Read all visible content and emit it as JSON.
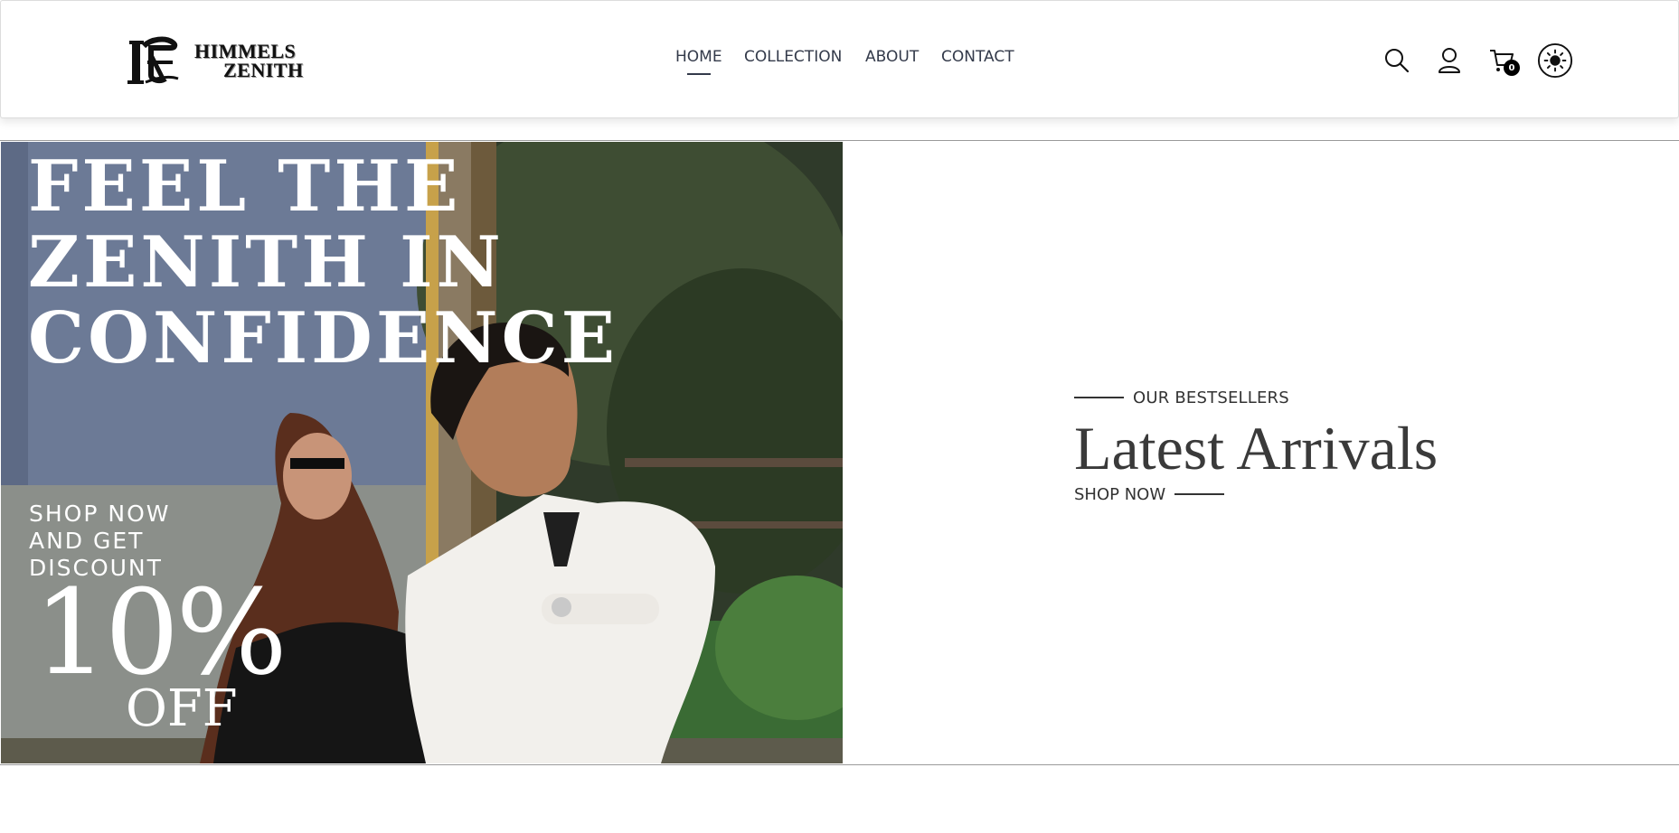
{
  "brand": {
    "line1": "HIMMELS",
    "line2": "ZENITH"
  },
  "nav": {
    "items": [
      {
        "label": "HOME",
        "active": true
      },
      {
        "label": "COLLECTION",
        "active": false
      },
      {
        "label": "ABOUT",
        "active": false
      },
      {
        "label": "CONTACT",
        "active": false
      }
    ]
  },
  "header_icons": {
    "search": "search-icon",
    "user": "user-icon",
    "cart": "cart-icon",
    "theme": "sun-icon",
    "cart_count": "0"
  },
  "hero_banner": {
    "headline": "FEEL THE ZENITH IN CONFIDENCE",
    "promo": "SHOP NOW AND GET DISCOUNT",
    "discount": "10%",
    "off": "OFF"
  },
  "hero": {
    "eyebrow": "OUR BESTSELLERS",
    "title": "Latest Arrivals",
    "cta": "SHOP NOW"
  },
  "colors": {
    "text_dark": "#333333",
    "nav_text": "#333a4a",
    "border": "#9a9a9a",
    "white": "#ffffff"
  }
}
